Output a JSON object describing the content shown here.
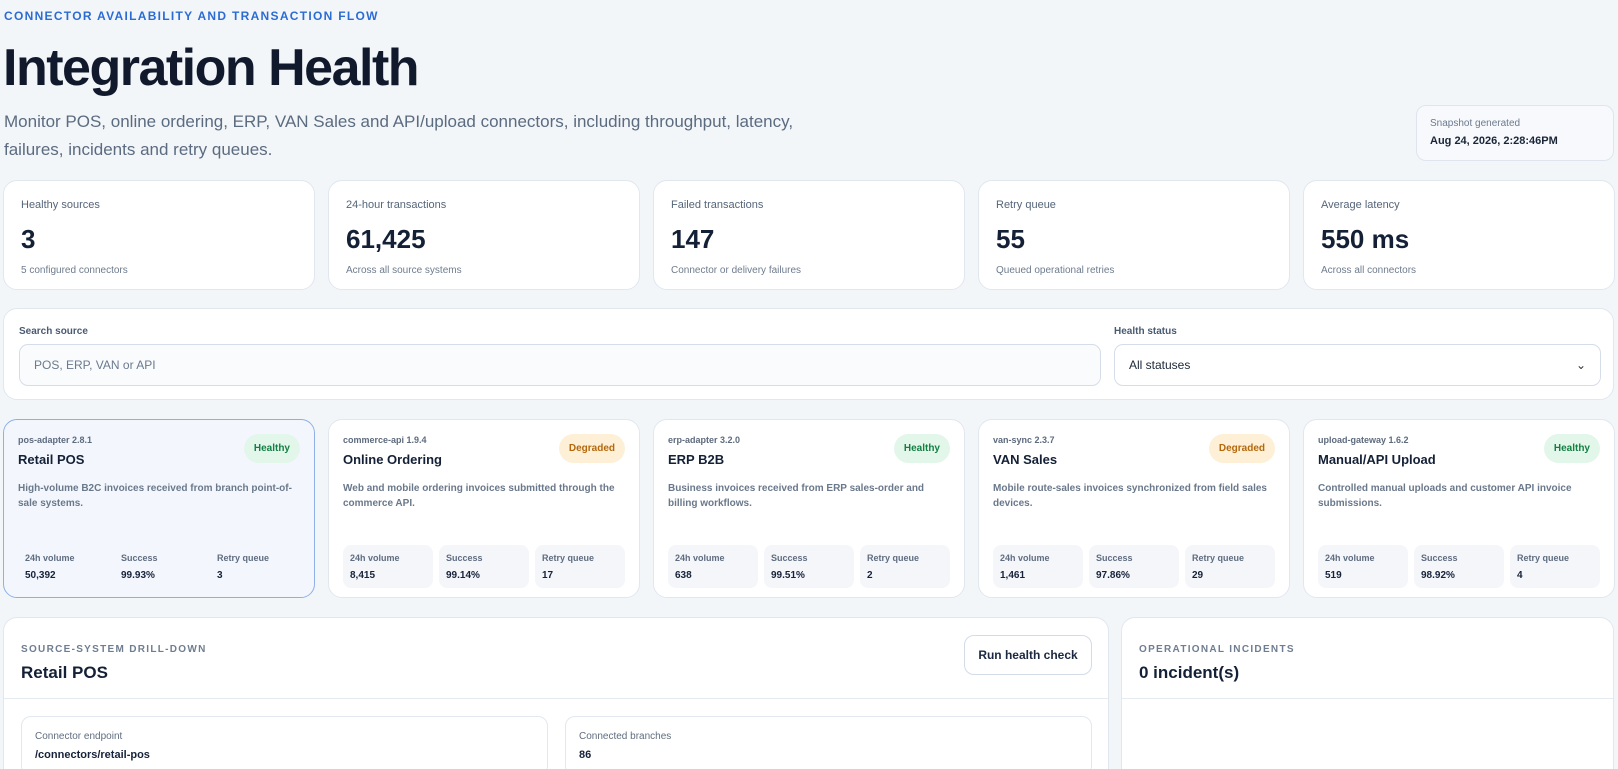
{
  "header": {
    "eyebrow": "CONNECTOR AVAILABILITY AND TRANSACTION FLOW",
    "title": "Integration Health",
    "subtitle": "Monitor POS, online ordering, ERP, VAN Sales and API/upload connectors, including throughput, latency, failures, incidents and retry queues."
  },
  "snapshot": {
    "label": "Snapshot generated",
    "value": "Aug 24, 2026, 2:28:46PM"
  },
  "kpis": [
    {
      "label": "Healthy sources",
      "value": "3",
      "note": "5 configured connectors"
    },
    {
      "label": "24-hour transactions",
      "value": "61,425",
      "note": "Across all source systems"
    },
    {
      "label": "Failed transactions",
      "value": "147",
      "note": "Connector or delivery failures"
    },
    {
      "label": "Retry queue",
      "value": "55",
      "note": "Queued operational retries"
    },
    {
      "label": "Average latency",
      "value": "550 ms",
      "note": "Across all connectors"
    }
  ],
  "filters": {
    "search_label": "Search source",
    "search_placeholder": "POS, ERP, VAN or API",
    "status_label": "Health status",
    "status_value": "All statuses"
  },
  "metric_labels": {
    "volume": "24h volume",
    "success": "Success",
    "retry": "Retry queue"
  },
  "sources": [
    {
      "version": "pos-adapter 2.8.1",
      "name": "Retail POS",
      "status": "Healthy",
      "desc": "High-volume B2C invoices received from branch point-of-sale systems.",
      "volume": "50,392",
      "success": "99.93%",
      "retry": "3"
    },
    {
      "version": "commerce-api 1.9.4",
      "name": "Online Ordering",
      "status": "Degraded",
      "desc": "Web and mobile ordering invoices submitted through the commerce API.",
      "volume": "8,415",
      "success": "99.14%",
      "retry": "17"
    },
    {
      "version": "erp-adapter 3.2.0",
      "name": "ERP B2B",
      "status": "Healthy",
      "desc": "Business invoices received from ERP sales-order and billing workflows.",
      "volume": "638",
      "success": "99.51%",
      "retry": "2"
    },
    {
      "version": "van-sync 2.3.7",
      "name": "VAN Sales",
      "status": "Degraded",
      "desc": "Mobile route-sales invoices synchronized from field sales devices.",
      "volume": "1,461",
      "success": "97.86%",
      "retry": "29"
    },
    {
      "version": "upload-gateway 1.6.2",
      "name": "Manual/API Upload",
      "status": "Healthy",
      "desc": "Controlled manual uploads and customer API invoice submissions.",
      "volume": "519",
      "success": "98.92%",
      "retry": "4"
    }
  ],
  "drilldown": {
    "eyebrow": "SOURCE-SYSTEM DRILL-DOWN",
    "title": "Retail POS",
    "button": "Run health check",
    "endpoint_label": "Connector endpoint",
    "endpoint_value": "/connectors/retail-pos",
    "branches_label": "Connected branches",
    "branches_value": "86"
  },
  "incidents": {
    "eyebrow": "OPERATIONAL INCIDENTS",
    "title": "0 incident(s)"
  },
  "colors": {
    "accent": "#2b6cd4",
    "healthy": "#138043",
    "degraded": "#b5680b"
  }
}
